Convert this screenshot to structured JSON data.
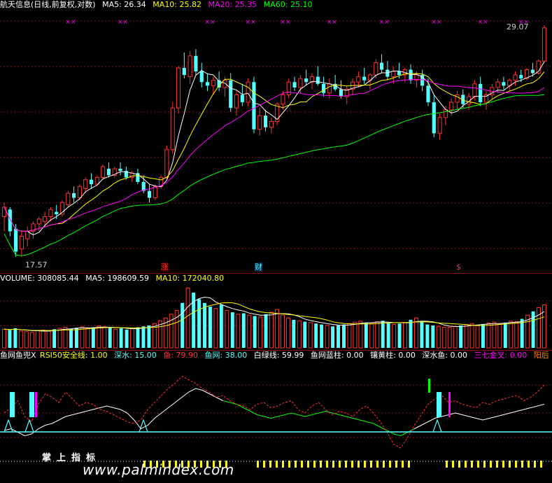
{
  "header": {
    "title": "航天信息(日线,前复权,对数)",
    "ma5": "MA5: 26.34",
    "ma10": "MA10: 25.82",
    "ma20": "MA20: 25.35",
    "ma60": "MA60: 25.10"
  },
  "price_labels": {
    "high": "29.07",
    "low": "17.57"
  },
  "event_labels": {
    "zhang": "涨",
    "cai": "财",
    "dollar": "$"
  },
  "volume_header": {
    "volume": "VOLUME: 308085.44",
    "ma5": "MA5: 198609.59",
    "ma10": "MA10: 172040.80"
  },
  "indicator_header": {
    "name": "鱼网鱼兜X",
    "rsi": "RSI50安全线: 1.00",
    "shen": "深水: 15.00",
    "yu": "鱼: 79.90",
    "yuwang": "鱼网: 38.00",
    "bailv": "白绿线: 59.99",
    "lanzhu": "鱼网蓝柱: 0.00",
    "huangzhu": "镶黄柱: 0.00",
    "shenshuiyu": "深水鱼: 0.00",
    "sanqi": "三七金叉: 0.00",
    "yang": "阳后"
  },
  "bottom_title": "掌上指标",
  "watermark": "www.palmindex.com",
  "colors": {
    "up": "#ff3232",
    "down": "#54ffff",
    "ma5": "#ffffff",
    "ma10": "#ffff00",
    "ma20": "#ff00ff",
    "ma60": "#00ff00",
    "grid": "#8a1010",
    "yellow": "#ffff00"
  },
  "chart_data": [
    {
      "type": "candlestick",
      "title": "航天信息(日线,前复权,对数)",
      "ylim": [
        17.57,
        29.07
      ],
      "ohlc": [
        [
          19.2,
          19.8,
          18.6,
          19.6
        ],
        [
          19.5,
          19.6,
          18.4,
          18.6
        ],
        [
          18.7,
          18.9,
          17.6,
          17.8
        ],
        [
          17.9,
          18.6,
          17.6,
          18.4
        ],
        [
          18.3,
          18.8,
          18.0,
          18.6
        ],
        [
          18.6,
          19.0,
          18.3,
          18.9
        ],
        [
          18.9,
          19.2,
          18.6,
          19.1
        ],
        [
          19.0,
          19.4,
          18.8,
          19.2
        ],
        [
          19.2,
          19.6,
          19.0,
          19.5
        ],
        [
          19.4,
          19.7,
          19.1,
          19.3
        ],
        [
          19.3,
          19.9,
          19.2,
          19.8
        ],
        [
          19.7,
          20.3,
          19.6,
          20.2
        ],
        [
          20.2,
          20.5,
          19.8,
          20.0
        ],
        [
          20.0,
          20.6,
          19.9,
          20.5
        ],
        [
          20.4,
          20.9,
          20.2,
          20.8
        ],
        [
          20.8,
          21.1,
          20.4,
          20.6
        ],
        [
          20.6,
          21.0,
          20.5,
          20.9
        ],
        [
          20.9,
          21.5,
          20.8,
          21.4
        ],
        [
          21.3,
          21.6,
          20.9,
          21.0
        ],
        [
          21.0,
          21.4,
          20.9,
          21.3
        ],
        [
          21.3,
          21.6,
          21.0,
          21.2
        ],
        [
          21.2,
          21.4,
          20.8,
          20.9
        ],
        [
          20.9,
          21.2,
          20.7,
          21.1
        ],
        [
          21.1,
          21.3,
          20.6,
          20.7
        ],
        [
          20.7,
          21.0,
          20.2,
          20.3
        ],
        [
          20.3,
          20.6,
          19.8,
          20.0
        ],
        [
          20.0,
          20.6,
          19.9,
          20.5
        ],
        [
          20.5,
          21.0,
          20.4,
          20.9
        ],
        [
          20.9,
          22.4,
          20.8,
          22.2
        ],
        [
          22.2,
          24.6,
          22.0,
          24.3
        ],
        [
          24.3,
          26.6,
          24.0,
          26.5
        ],
        [
          26.5,
          27.4,
          25.9,
          26.1
        ],
        [
          26.0,
          27.5,
          25.6,
          27.2
        ],
        [
          27.2,
          27.6,
          26.1,
          26.3
        ],
        [
          26.3,
          26.8,
          25.4,
          25.7
        ],
        [
          25.7,
          26.2,
          25.2,
          25.5
        ],
        [
          25.5,
          26.0,
          25.0,
          25.8
        ],
        [
          25.8,
          26.3,
          25.2,
          25.4
        ],
        [
          25.4,
          26.0,
          24.9,
          25.8
        ],
        [
          25.8,
          26.2,
          24.1,
          24.3
        ],
        [
          24.3,
          25.2,
          23.9,
          25.0
        ],
        [
          25.0,
          25.6,
          24.4,
          24.6
        ],
        [
          24.6,
          25.9,
          24.4,
          25.7
        ],
        [
          25.7,
          26.0,
          23.0,
          23.2
        ],
        [
          23.2,
          24.3,
          22.9,
          23.9
        ],
        [
          23.9,
          24.2,
          23.1,
          23.3
        ],
        [
          23.3,
          23.8,
          23.0,
          23.6
        ],
        [
          23.6,
          24.6,
          23.4,
          24.5
        ],
        [
          24.5,
          25.2,
          24.2,
          25.0
        ],
        [
          25.0,
          25.9,
          24.8,
          25.7
        ],
        [
          25.7,
          26.0,
          25.2,
          25.4
        ],
        [
          25.4,
          26.1,
          25.1,
          25.9
        ],
        [
          25.9,
          26.4,
          25.5,
          25.7
        ],
        [
          25.7,
          26.2,
          25.3,
          26.0
        ],
        [
          26.0,
          26.6,
          25.5,
          25.6
        ],
        [
          25.6,
          26.0,
          24.9,
          25.1
        ],
        [
          25.1,
          25.9,
          24.8,
          25.6
        ],
        [
          25.6,
          26.1,
          25.2,
          25.3
        ],
        [
          25.3,
          25.8,
          24.8,
          24.9
        ],
        [
          24.9,
          25.5,
          24.5,
          25.3
        ],
        [
          25.3,
          25.9,
          25.0,
          25.7
        ],
        [
          25.7,
          26.3,
          25.4,
          26.0
        ],
        [
          26.0,
          26.5,
          25.6,
          25.8
        ],
        [
          25.8,
          26.2,
          25.3,
          26.1
        ],
        [
          26.1,
          27.0,
          25.9,
          26.8
        ],
        [
          26.8,
          27.3,
          26.2,
          26.4
        ],
        [
          26.4,
          26.9,
          25.8,
          26.0
        ],
        [
          26.0,
          26.6,
          25.6,
          26.3
        ],
        [
          26.3,
          26.8,
          25.9,
          26.1
        ],
        [
          26.1,
          26.5,
          25.7,
          26.4
        ],
        [
          26.4,
          26.7,
          25.6,
          25.8
        ],
        [
          25.8,
          26.3,
          25.4,
          26.1
        ],
        [
          26.1,
          26.4,
          25.2,
          25.5
        ],
        [
          25.5,
          25.9,
          24.4,
          24.6
        ],
        [
          24.6,
          25.0,
          22.8,
          23.0
        ],
        [
          23.0,
          24.0,
          22.7,
          23.8
        ],
        [
          23.8,
          24.4,
          23.4,
          24.2
        ],
        [
          24.2,
          24.8,
          23.9,
          24.6
        ],
        [
          24.6,
          25.2,
          24.2,
          25.0
        ],
        [
          25.0,
          25.3,
          24.3,
          24.5
        ],
        [
          24.5,
          25.1,
          24.2,
          24.9
        ],
        [
          24.9,
          25.8,
          24.7,
          25.6
        ],
        [
          25.6,
          26.0,
          24.4,
          24.6
        ],
        [
          24.6,
          25.2,
          24.2,
          25.0
        ],
        [
          25.0,
          25.6,
          24.8,
          25.4
        ],
        [
          25.4,
          25.9,
          25.1,
          25.7
        ],
        [
          25.7,
          26.0,
          25.3,
          25.5
        ],
        [
          25.5,
          25.9,
          25.2,
          25.8
        ],
        [
          25.8,
          26.3,
          25.5,
          26.1
        ],
        [
          26.1,
          26.4,
          25.7,
          25.9
        ],
        [
          25.9,
          26.5,
          25.8,
          26.4
        ],
        [
          26.4,
          26.8,
          26.0,
          26.2
        ],
        [
          26.2,
          27.0,
          26.1,
          26.9
        ],
        [
          26.9,
          29.07,
          26.8,
          28.9
        ]
      ]
    },
    {
      "type": "bar",
      "title": "VOLUME",
      "values": [
        40,
        38,
        42,
        36,
        35,
        33,
        37,
        38,
        36,
        40,
        42,
        44,
        41,
        43,
        45,
        42,
        44,
        47,
        45,
        43,
        40,
        42,
        39,
        41,
        44,
        46,
        48,
        52,
        58,
        64,
        72,
        80,
        96,
        128,
        118,
        104,
        96,
        88,
        84,
        92,
        80,
        76,
        72,
        74,
        70,
        68,
        66,
        72,
        76,
        82,
        70,
        64,
        60,
        58,
        56,
        54,
        52,
        50,
        48,
        46,
        48,
        50,
        52,
        55,
        57,
        54,
        52,
        56,
        58,
        54,
        50,
        52,
        54,
        60,
        64,
        56,
        50,
        48,
        46,
        44,
        44,
        46,
        48,
        50,
        52,
        49,
        51,
        53,
        55,
        52,
        54,
        57,
        56,
        62,
        70,
        78,
        86,
        92
      ]
    },
    {
      "type": "line",
      "title": "鱼网鱼兜X",
      "series": [
        {
          "name": "白绿线",
          "values": [
            28,
            30,
            26,
            22,
            24,
            30,
            34,
            36,
            40,
            44,
            46,
            48,
            50,
            52,
            54,
            56,
            54,
            52,
            48,
            40,
            30,
            34,
            42,
            48,
            54,
            60,
            66,
            72,
            76,
            74,
            70,
            66,
            62,
            60,
            58,
            54,
            50,
            46,
            44,
            42,
            44,
            46,
            48,
            46,
            44,
            46,
            48,
            50,
            48,
            46,
            44,
            42,
            40,
            38,
            36,
            32,
            28,
            24,
            22,
            26,
            30,
            34,
            38,
            42,
            44,
            46,
            48,
            46,
            44,
            42,
            40,
            42,
            44,
            46,
            48,
            50,
            52,
            54,
            56,
            58
          ]
        },
        {
          "name": "鱼",
          "values": [
            48,
            54,
            62,
            44,
            38,
            58,
            70,
            66,
            60,
            72,
            64,
            56,
            60,
            58,
            52,
            50,
            46,
            42,
            38,
            36,
            40,
            52,
            60,
            68,
            76,
            82,
            90,
            86,
            82,
            76,
            72,
            66,
            68,
            62,
            58,
            56,
            52,
            58,
            60,
            54,
            56,
            60,
            62,
            52,
            48,
            56,
            60,
            52,
            46,
            50,
            48,
            44,
            52,
            56,
            48,
            38,
            26,
            12,
            8,
            20,
            34,
            46,
            58,
            64,
            68,
            60,
            62,
            58,
            56,
            54,
            60,
            58,
            62,
            64,
            66,
            68,
            62,
            66,
            72,
            80
          ]
        }
      ]
    }
  ]
}
